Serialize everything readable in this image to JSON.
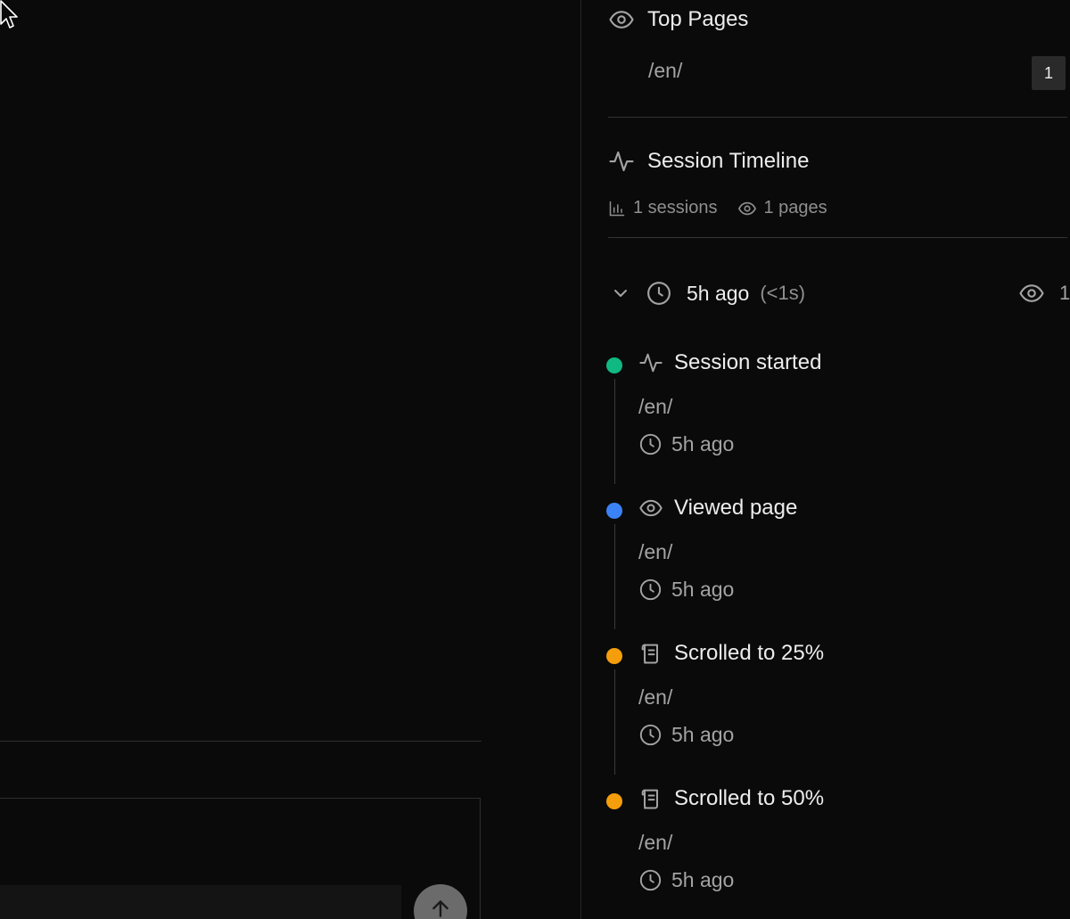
{
  "top_pages": {
    "title": "Top Pages",
    "icon": "eye-icon",
    "rows": [
      {
        "path": "/en/",
        "count": "1"
      }
    ]
  },
  "session_timeline": {
    "title": "Session Timeline",
    "icon": "activity-icon",
    "stats": {
      "sessions": "1 sessions",
      "pages": "1 pages"
    },
    "session": {
      "time": "5h ago",
      "duration": "(<1s)",
      "views": "1",
      "events": [
        {
          "title": "Session started",
          "path": "/en/",
          "time": "5h ago",
          "color": "#10b981",
          "icon": "activity-icon"
        },
        {
          "title": "Viewed page",
          "path": "/en/",
          "time": "5h ago",
          "color": "#3b82f6",
          "icon": "eye-icon"
        },
        {
          "title": "Scrolled to 25%",
          "path": "/en/",
          "time": "5h ago",
          "color": "#f59e0b",
          "icon": "scroll-icon"
        },
        {
          "title": "Scrolled to 50%",
          "path": "/en/",
          "time": "5h ago",
          "color": "#f59e0b",
          "icon": "scroll-icon"
        }
      ]
    }
  },
  "composer": {
    "send_icon": "arrow-up-icon"
  }
}
